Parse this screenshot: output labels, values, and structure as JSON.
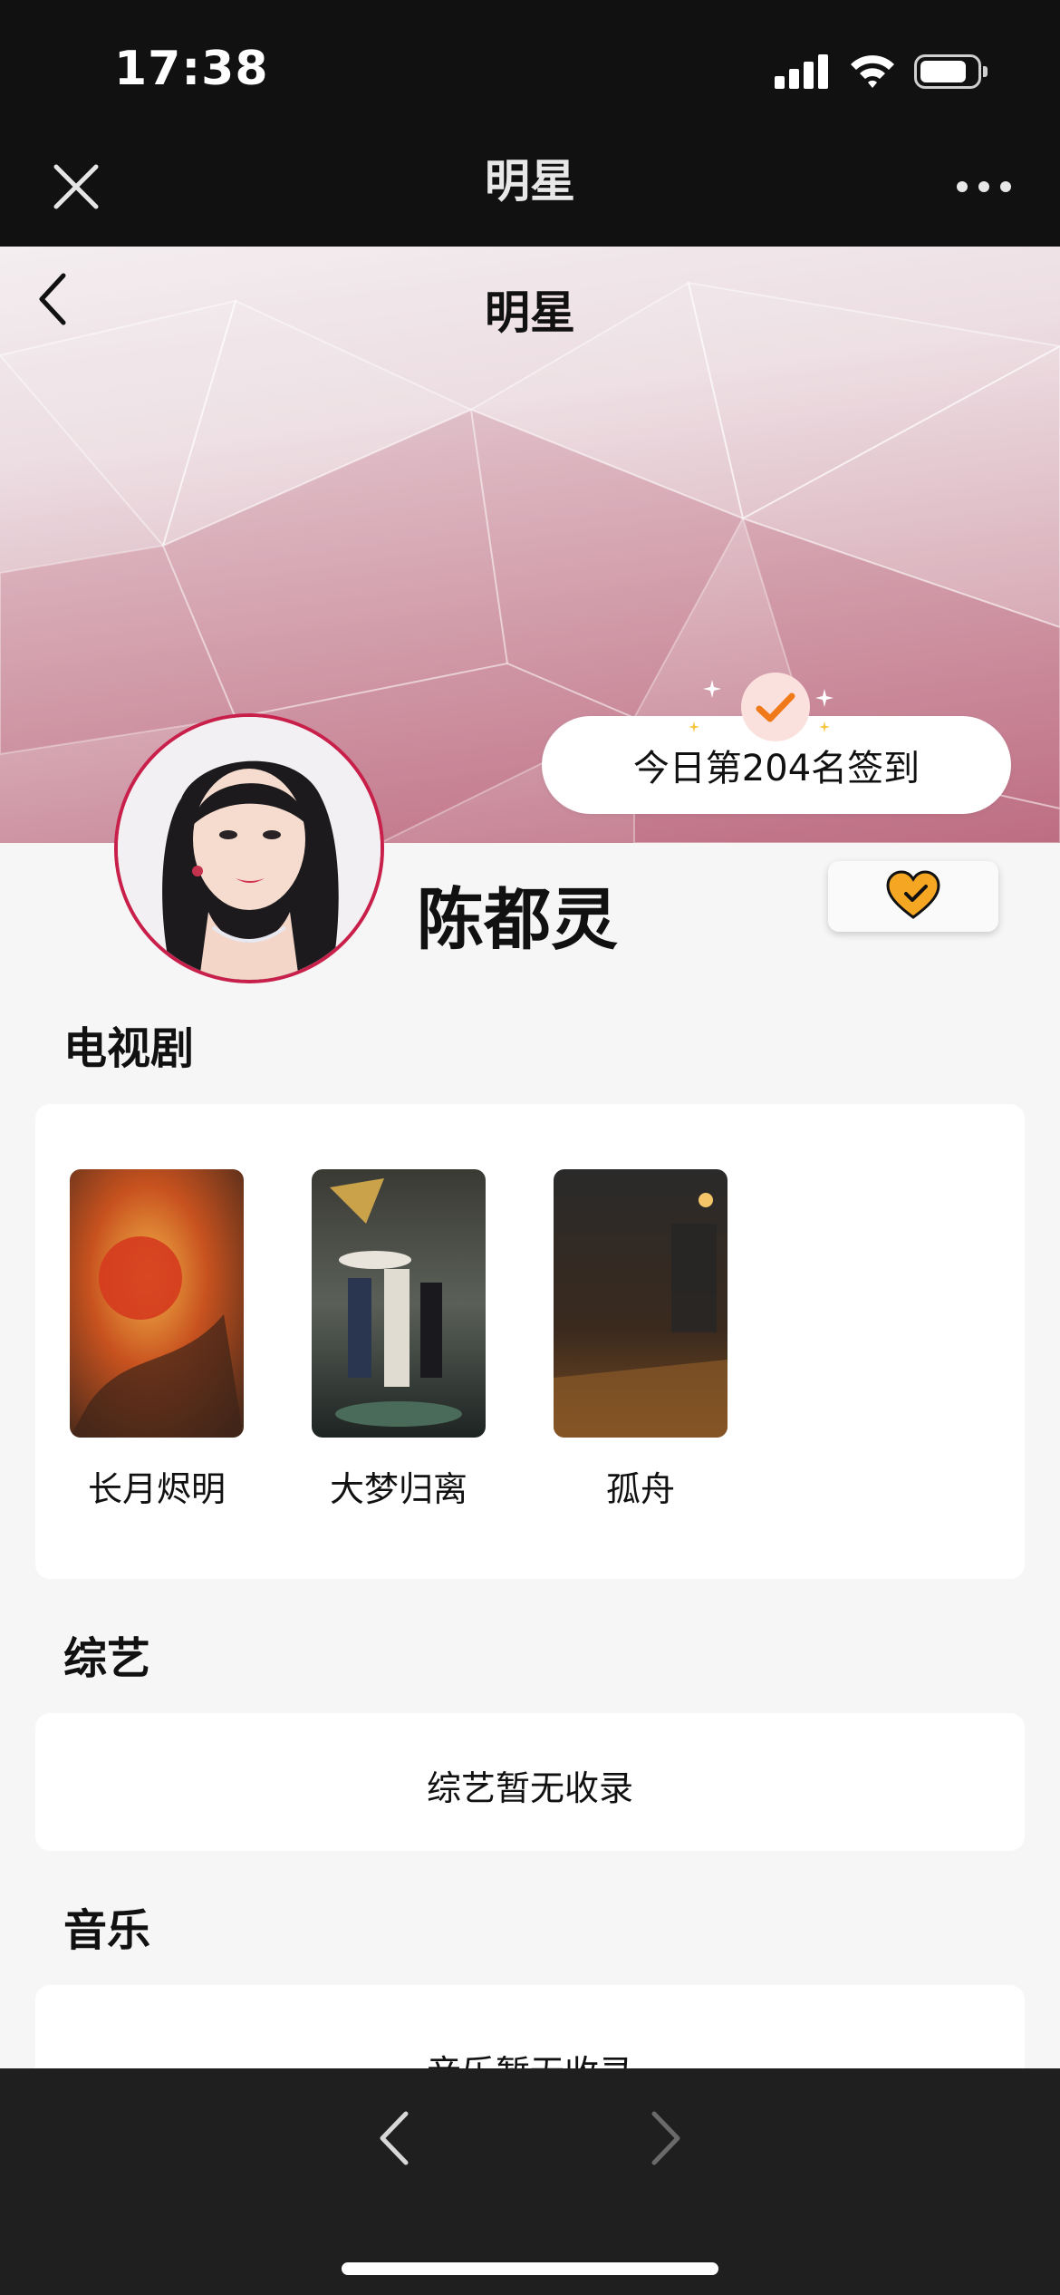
{
  "status_bar": {
    "time": "17:38"
  },
  "wechat_header": {
    "title": "明星"
  },
  "page": {
    "title": "明星",
    "checkin_text": "今日第204名签到",
    "star_name": "陈都灵",
    "accent_color": "#c8204a",
    "follow_icon_color": "#f5a623"
  },
  "sections": {
    "tv": {
      "title": "电视剧",
      "items": [
        {
          "title": "长月烬明"
        },
        {
          "title": "大梦归离"
        },
        {
          "title": "孤舟"
        }
      ]
    },
    "variety": {
      "title": "综艺",
      "empty_text": "综艺暂无收录"
    },
    "music": {
      "title": "音乐",
      "empty_text": "音乐暂无收录"
    }
  },
  "icons": {
    "close": "close-icon",
    "more": "more-icon",
    "back": "chevron-left-icon",
    "follow": "heart-check-icon",
    "nav_back": "chevron-left-icon",
    "nav_forward": "chevron-right-icon"
  }
}
